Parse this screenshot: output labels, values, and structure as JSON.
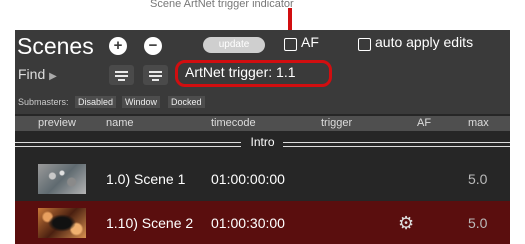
{
  "callout": {
    "text": "Scene ArtNet trigger indicator"
  },
  "panel": {
    "title": "Scenes",
    "add_button": "+",
    "remove_button": "−",
    "update_button": "update",
    "af_checkbox_label": "AF",
    "auto_apply_label": "auto apply edits",
    "find_label": "Find",
    "find_arrow": "▶",
    "artnet_trigger": "ArtNet trigger: 1.1",
    "submasters": {
      "label": "Submasters:",
      "options": [
        "Disabled",
        "Window",
        "Docked"
      ]
    },
    "columns": [
      "preview",
      "name",
      "timecode",
      "trigger",
      "AF",
      "max"
    ],
    "group": "Intro",
    "rows": [
      {
        "name": "1.0) Scene 1",
        "timecode": "01:00:00:00",
        "trigger": "",
        "af": "",
        "max": "5.0",
        "selected": false
      },
      {
        "name": "1.10) Scene 2",
        "timecode": "01:00:30:00",
        "trigger": "",
        "af": "⚙",
        "max": "5.0",
        "selected": true
      }
    ]
  },
  "colors": {
    "highlight_red": "#d10e10",
    "panel_bg": "#262626",
    "header_bg": "#3a3a3a",
    "selected_row": "#5a0e0e"
  }
}
